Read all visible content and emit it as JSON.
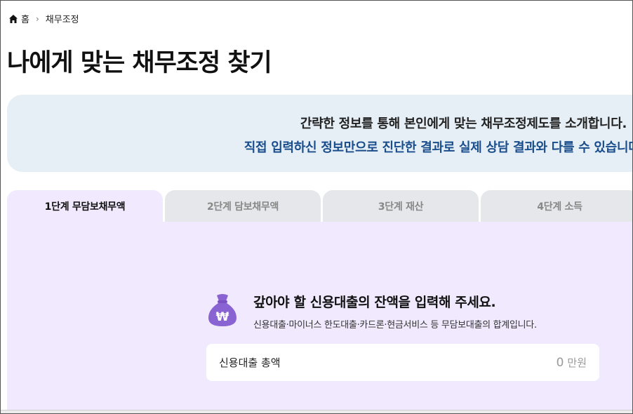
{
  "breadcrumb": {
    "home": "홈",
    "separator": "›",
    "current": "채무조정"
  },
  "page_title": "나에게 맞는 채무조정 찾기",
  "notice": {
    "line1": "간략한 정보를 통해 본인에게 맞는 채무조정제도를 소개합니다.",
    "line2": "직접 입력하신 정보만으로 진단한 결과로 실제 상담 결과와 다를 수 있습니다.",
    "line2_color": "#1a4d8c",
    "background": "#e6eff6"
  },
  "tabs": [
    {
      "label": "1단계 무담보채무액",
      "active": true
    },
    {
      "label": "2단계 담보채무액",
      "active": false
    },
    {
      "label": "3단계 재산",
      "active": false
    },
    {
      "label": "4단계 소득",
      "active": false
    }
  ],
  "step": {
    "icon": "money-bag-icon",
    "icon_symbol": "₩",
    "icon_color": "#8a63d2",
    "question": "갚아야 할 신용대출의 잔액을 입력해 주세요.",
    "hint": "신용대출·마이너스 한도대출·카드론·현금서비스 등 무담보대출의 합계입니다.",
    "field": {
      "label": "신용대출 총액",
      "value": "0",
      "unit": "만원"
    },
    "panel_background": "#f1e9fd"
  }
}
